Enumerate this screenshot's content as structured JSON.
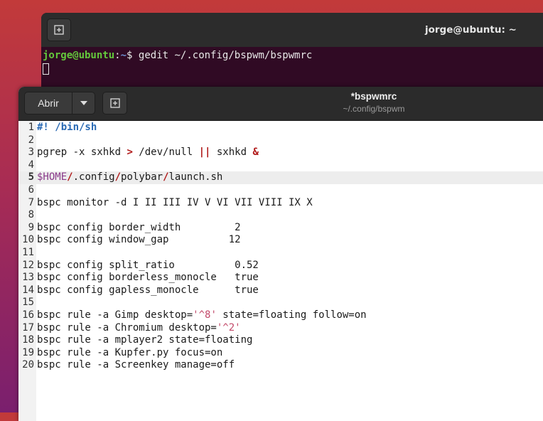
{
  "terminal": {
    "title": "jorge@ubuntu: ~",
    "prompt_user": "jorge@ubuntu",
    "prompt_sep": ":",
    "prompt_path": "~",
    "prompt_symbol": "$",
    "command": "gedit ~/.config/bspwm/bspwmrc"
  },
  "gedit": {
    "open_label": "Abrir",
    "title": "*bspwmrc",
    "subtitle": "~/.config/bspwm",
    "current_line": 5,
    "lines": [
      {
        "n": "1",
        "parts": [
          {
            "t": "#! /bin/sh",
            "c": "sh"
          }
        ]
      },
      {
        "n": "2",
        "parts": []
      },
      {
        "n": "3",
        "parts": [
          {
            "t": "pgrep -x sxhkd ",
            "c": ""
          },
          {
            "t": ">",
            "c": "op"
          },
          {
            "t": " /dev/null ",
            "c": ""
          },
          {
            "t": "||",
            "c": "op"
          },
          {
            "t": " sxhkd ",
            "c": ""
          },
          {
            "t": "&",
            "c": "op"
          }
        ]
      },
      {
        "n": "4",
        "parts": []
      },
      {
        "n": "5",
        "parts": [
          {
            "t": "$HOME",
            "c": "var"
          },
          {
            "t": "/",
            "c": "op"
          },
          {
            "t": ".config",
            "c": ""
          },
          {
            "t": "/",
            "c": "op"
          },
          {
            "t": "polybar",
            "c": ""
          },
          {
            "t": "/",
            "c": "op"
          },
          {
            "t": "launch.sh",
            "c": ""
          }
        ]
      },
      {
        "n": "6",
        "parts": []
      },
      {
        "n": "7",
        "parts": [
          {
            "t": "bspc monitor -d I II III IV V VI VII VIII IX X",
            "c": ""
          }
        ]
      },
      {
        "n": "8",
        "parts": []
      },
      {
        "n": "9",
        "parts": [
          {
            "t": "bspc config border_width         2",
            "c": ""
          }
        ]
      },
      {
        "n": "10",
        "parts": [
          {
            "t": "bspc config window_gap          12",
            "c": ""
          }
        ]
      },
      {
        "n": "11",
        "parts": []
      },
      {
        "n": "12",
        "parts": [
          {
            "t": "bspc config split_ratio          0.52",
            "c": ""
          }
        ]
      },
      {
        "n": "13",
        "parts": [
          {
            "t": "bspc config borderless_monocle   true",
            "c": ""
          }
        ]
      },
      {
        "n": "14",
        "parts": [
          {
            "t": "bspc config gapless_monocle      true",
            "c": ""
          }
        ]
      },
      {
        "n": "15",
        "parts": []
      },
      {
        "n": "16",
        "parts": [
          {
            "t": "bspc rule -a Gimp desktop=",
            "c": ""
          },
          {
            "t": "'^8'",
            "c": "str"
          },
          {
            "t": " state=floating follow=on",
            "c": ""
          }
        ]
      },
      {
        "n": "17",
        "parts": [
          {
            "t": "bspc rule -a Chromium desktop=",
            "c": ""
          },
          {
            "t": "'^2'",
            "c": "str"
          }
        ]
      },
      {
        "n": "18",
        "parts": [
          {
            "t": "bspc rule -a mplayer2 state=floating",
            "c": ""
          }
        ]
      },
      {
        "n": "19",
        "parts": [
          {
            "t": "bspc rule -a Kupfer.py focus=on",
            "c": ""
          }
        ]
      },
      {
        "n": "20",
        "parts": [
          {
            "t": "bspc rule -a Screenkey manage=off",
            "c": ""
          }
        ]
      }
    ]
  },
  "icons": {
    "new_tab": "new-tab-icon",
    "dropdown": "chevron-down-icon"
  }
}
